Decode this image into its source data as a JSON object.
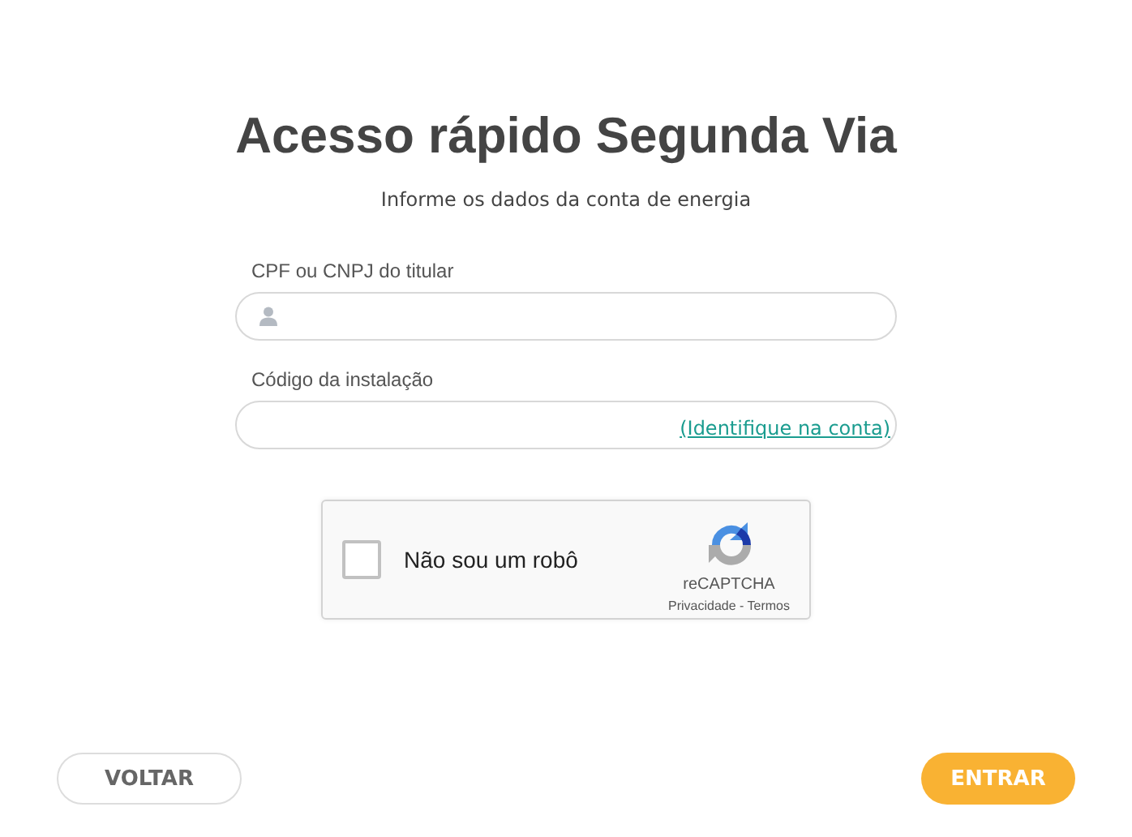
{
  "title": "Acesso rápido Segunda Via",
  "subtitle": "Informe os dados da conta de energia",
  "fields": [
    {
      "label": "CPF ou CNPJ do titular",
      "kind": "person"
    },
    {
      "label": "Código da instalação",
      "kind": "link",
      "link": "(Identifique na conta)"
    }
  ],
  "captcha": {
    "label": "Não sou um robô",
    "checked": false,
    "brand": "reCAPTCHA",
    "links": "Privacidade - Termos"
  },
  "buttons": [
    {
      "label": "VOLTAR",
      "kind": "secondary"
    },
    {
      "label": "ENTRAR",
      "kind": "primary"
    }
  ]
}
